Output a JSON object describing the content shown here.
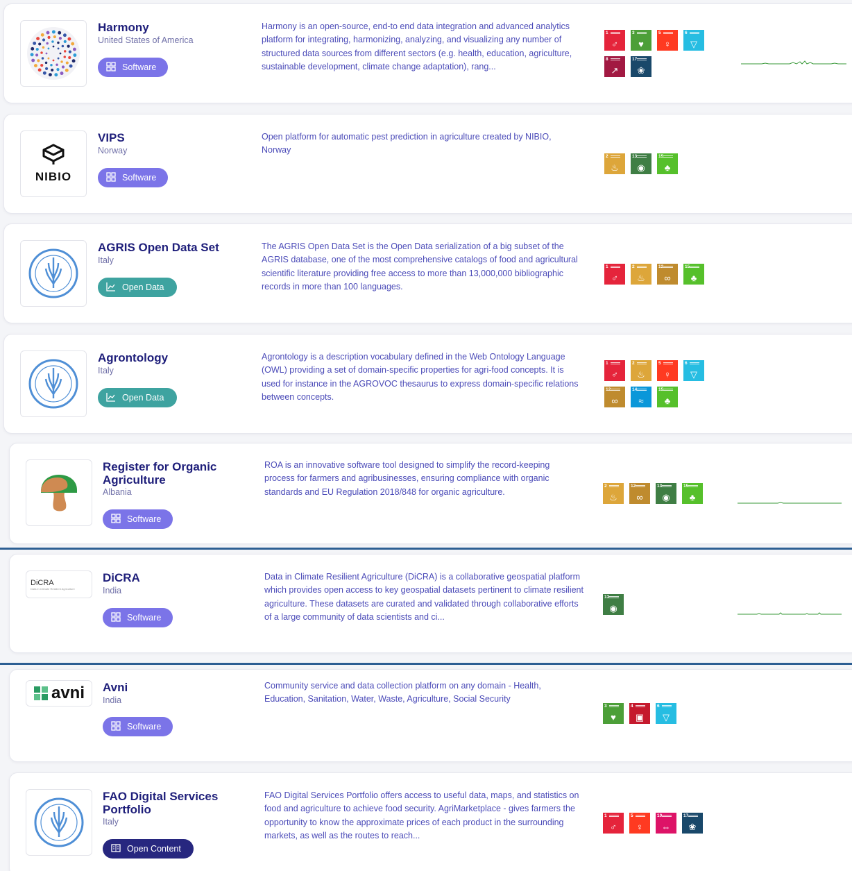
{
  "cards": [
    {
      "title": "Harmony",
      "country": "United States of America",
      "badge": "Software",
      "description": "Harmony is an open-source, end-to end data integration and advanced analytics platform for integrating, harmonizing, analyzing, and visualizing any number of structured data sources from different sectors (e.g. health, education, agriculture, sustainable development, climate change adaptation), rang...",
      "sdgs": [
        1,
        3,
        5,
        6,
        8,
        17
      ],
      "logo": "harmony-logo"
    },
    {
      "title": "VIPS",
      "country": "Norway",
      "badge": "Software",
      "logo_text": "NIBIO",
      "description": "Open platform for automatic pest prediction in agriculture created by NIBIO, Norway",
      "sdgs": [
        2,
        13,
        15
      ],
      "logo": "nibio-logo"
    },
    {
      "title": "AGRIS Open Data Set",
      "country": "Italy",
      "badge": "Open Data",
      "description": "The AGRIS Open Data Set is the Open Data serialization of a big subset of the AGRIS database, one of the most comprehensive catalogs of food and agricultural scientific literature providing free access to more than 13,000,000 bibliographic records in more than 100 languages.",
      "sdgs": [
        1,
        2,
        12,
        15
      ],
      "logo": "fao-logo"
    },
    {
      "title": "Agrontology",
      "country": "Italy",
      "badge": "Open Data",
      "description": "Agrontology is a description vocabulary defined in the Web Ontology Language (OWL) providing a set of domain-specific properties for agri-food concepts. It is used for instance in the AGROVOC thesaurus to express domain-specific relations between concepts.",
      "sdgs": [
        1,
        2,
        5,
        6,
        12,
        14,
        15
      ],
      "logo": "fao-logo"
    },
    {
      "title": "Register for Organic Agriculture",
      "country": "Albania",
      "badge": "Software",
      "description": "ROA is an innovative software tool designed to simplify the record-keeping process for farmers and agribusinesses, ensuring compliance with organic standards and EU Regulation 2018/848 for organic agriculture.",
      "sdgs": [
        2,
        12,
        13,
        15
      ],
      "logo": "mushroom-logo"
    },
    {
      "title": "DiCRA",
      "country": "India",
      "badge": "Software",
      "logo_text": "DiCRA",
      "logo_subtext": "Data in Climate Resilient Agriculture",
      "description": "Data in Climate Resilient Agriculture (DiCRA) is a collaborative geospatial platform which provides open access to key geospatial datasets pertinent to climate resilient agriculture. These datasets are curated and validated through collaborative efforts of a large community of data scientists and ci...",
      "sdgs": [
        13
      ],
      "logo": "dicra-logo"
    },
    {
      "title": "Avni",
      "country": "India",
      "badge": "Software",
      "logo_text": "avni",
      "description": "Community service and data collection platform on any domain - Health, Education, Sanitation, Water, Waste, Agriculture, Social Security",
      "sdgs": [
        3,
        4,
        6
      ],
      "logo": "avni-logo"
    },
    {
      "title": "FAO Digital Services Portfolio",
      "country": "Italy",
      "badge": "Open Content",
      "description": "FAO Digital Services Portfolio offers access to useful data, maps, and statistics on food and agriculture to achieve food security. AgriMarketplace - gives farmers the opportunity to know the approximate prices of each product in the surrounding markets, as well as the routes to reach...",
      "sdgs": [
        1,
        5,
        10,
        17
      ],
      "logo": "fao-logo"
    }
  ],
  "colors": {
    "sdg1": "#e5243b",
    "sdg2": "#dda63a",
    "sdg3": "#4c9f38",
    "sdg4": "#c5192d",
    "sdg5": "#ff3a21",
    "sdg6": "#26bde2",
    "sdg8": "#a21942",
    "sdg10": "#dd1367",
    "sdg12": "#bf8b2e",
    "sdg13": "#3f7e44",
    "sdg14": "#0a97d9",
    "sdg15": "#56c02b",
    "sdg17": "#19486a",
    "separator": "#2d5f93",
    "spark": "#3a9a3a"
  }
}
